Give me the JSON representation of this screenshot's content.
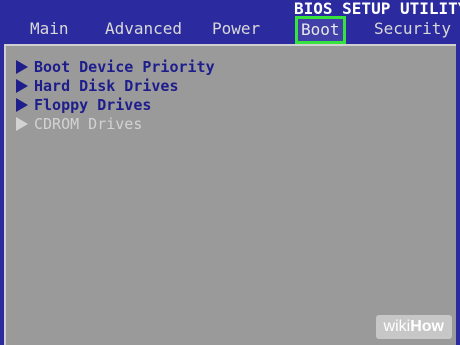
{
  "header": {
    "utility_title": "BIOS SETUP UTILITY"
  },
  "tabs": [
    {
      "label": "Main",
      "active": false
    },
    {
      "label": "Advanced",
      "active": false
    },
    {
      "label": "Power",
      "active": false
    },
    {
      "label": "Boot",
      "active": true
    },
    {
      "label": "Security",
      "active": false
    }
  ],
  "menu": {
    "items": [
      {
        "label": "Boot Device Priority",
        "enabled": true
      },
      {
        "label": "Hard Disk Drives",
        "enabled": true
      },
      {
        "label": "Floppy Drives",
        "enabled": true
      },
      {
        "label": "CDROM Drives",
        "enabled": false
      }
    ]
  },
  "watermark": {
    "part1": "wiki",
    "part2": "How"
  },
  "colors": {
    "background": "#2b2b9f",
    "panel": "#9a9a9a",
    "menu_text": "#1d1d8c",
    "disabled_text": "#d2d2d2",
    "active_tab_highlight": "#38e23c"
  }
}
